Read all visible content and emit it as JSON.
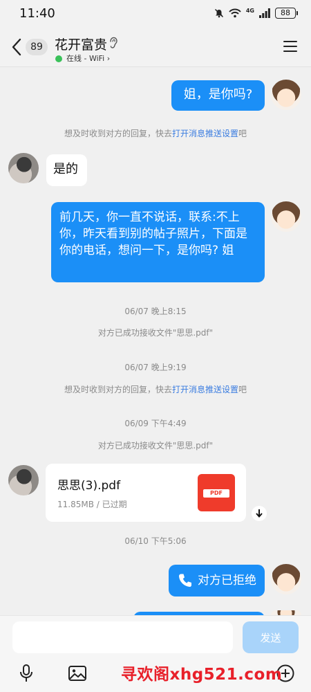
{
  "status_bar": {
    "time": "11:40",
    "network": "4G",
    "battery": "88",
    "icons": [
      "mute-icon",
      "wifi-icon",
      "signal-icon",
      "battery-icon"
    ]
  },
  "header": {
    "unread_count": "89",
    "contact_name": "花开富贵",
    "status_text": "在线 - WiFi",
    "status_chevron": "›",
    "online_color": "#3ac15a"
  },
  "messages": {
    "m1_text": "姐，是你吗?",
    "sys1_prefix": "想及时收到对方的回复，快去",
    "sys1_link": "打开消息推送设置",
    "sys1_suffix": "吧",
    "m2_text": "是的",
    "m3_text": "前几天，你一直不说话，联系:不上你，昨天看到别的帖子照片，下面是你的电话，想问一下，是你吗? 姐",
    "ts1": "06/07 晚上8:15",
    "sys2": "对方已成功接收文件\"思思.pdf\"",
    "ts2": "06/07 晚上9:19",
    "sys3_prefix": "想及时收到对方的回复，快去",
    "sys3_link": "打开消息推送设置",
    "sys3_suffix": "吧",
    "ts3": "06/09 下午4:49",
    "sys4": "对方已成功接收文件\"思思.pdf\"",
    "file_name": "思思(3).pdf",
    "file_meta": "11.85MB / 已过期",
    "file_icon_label": "PDF",
    "ts4": "06/10 下午5:06",
    "call_text": "对方已拒绝"
  },
  "input_bar": {
    "input_value": "",
    "send_label": "发送",
    "tools": [
      "microphone-icon",
      "image-icon",
      "add-icon"
    ]
  },
  "watermark": "寻欢阁xhg521.com",
  "colors": {
    "bubble_me": "#1b8ff7",
    "bubble_other": "#ffffff",
    "link": "#3a7ce0",
    "pdf_red": "#ef3b2b"
  }
}
